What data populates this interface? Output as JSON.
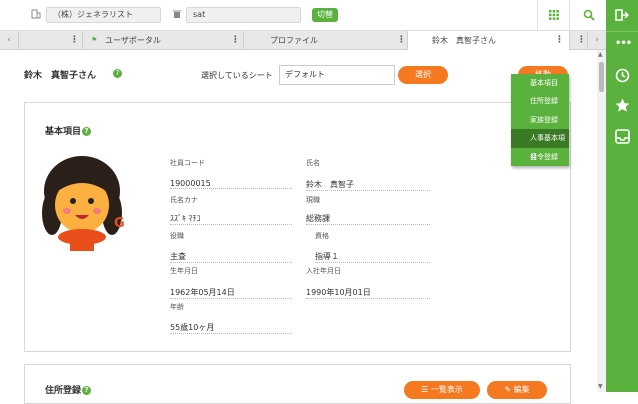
{
  "topbar": {
    "company": "（株）ジェネラリスト",
    "user_query": "sat",
    "switch_label": "切替"
  },
  "tabs": [
    {
      "label": "ユーザポータル"
    },
    {
      "label": "プロファイル"
    },
    {
      "label": "鈴木　真智子さん"
    }
  ],
  "header": {
    "person_name": "鈴木　真智子さん",
    "sheet_label": "選択しているシート",
    "sheet_value": "デフォルト",
    "select_button": "選択",
    "move_button": "移動"
  },
  "dropdown": {
    "items": [
      {
        "label": "基本項目"
      },
      {
        "label": "住所登録"
      },
      {
        "label": "家族登録"
      },
      {
        "label": "人事基本項目"
      },
      {
        "label": "発令登録"
      }
    ]
  },
  "basic": {
    "title": "基本項目",
    "fields": {
      "employee_code_label": "社員コード",
      "employee_code": "19000015",
      "name_label": "氏名",
      "name": "鈴木　真智子",
      "kana_label": "氏名カナ",
      "kana": "ｽｽﾞｷ ﾏﾁｺ",
      "title_label": "現職",
      "dept": "総務課",
      "role_label": "役職",
      "grade_label": "資格",
      "role": "主査",
      "grade": "指導１",
      "birth_label": "生年月日",
      "join_label": "入社年月日",
      "birth": "1962年05月14日",
      "join": "1990年10月01日",
      "age_label": "年齢",
      "age": "55歳10ヶ月"
    }
  },
  "address": {
    "title": "住所登録",
    "list_button": "一覧表示",
    "edit_button": "編集"
  },
  "colors": {
    "brand_green": "#5bb13d",
    "orange": "#f47920"
  }
}
